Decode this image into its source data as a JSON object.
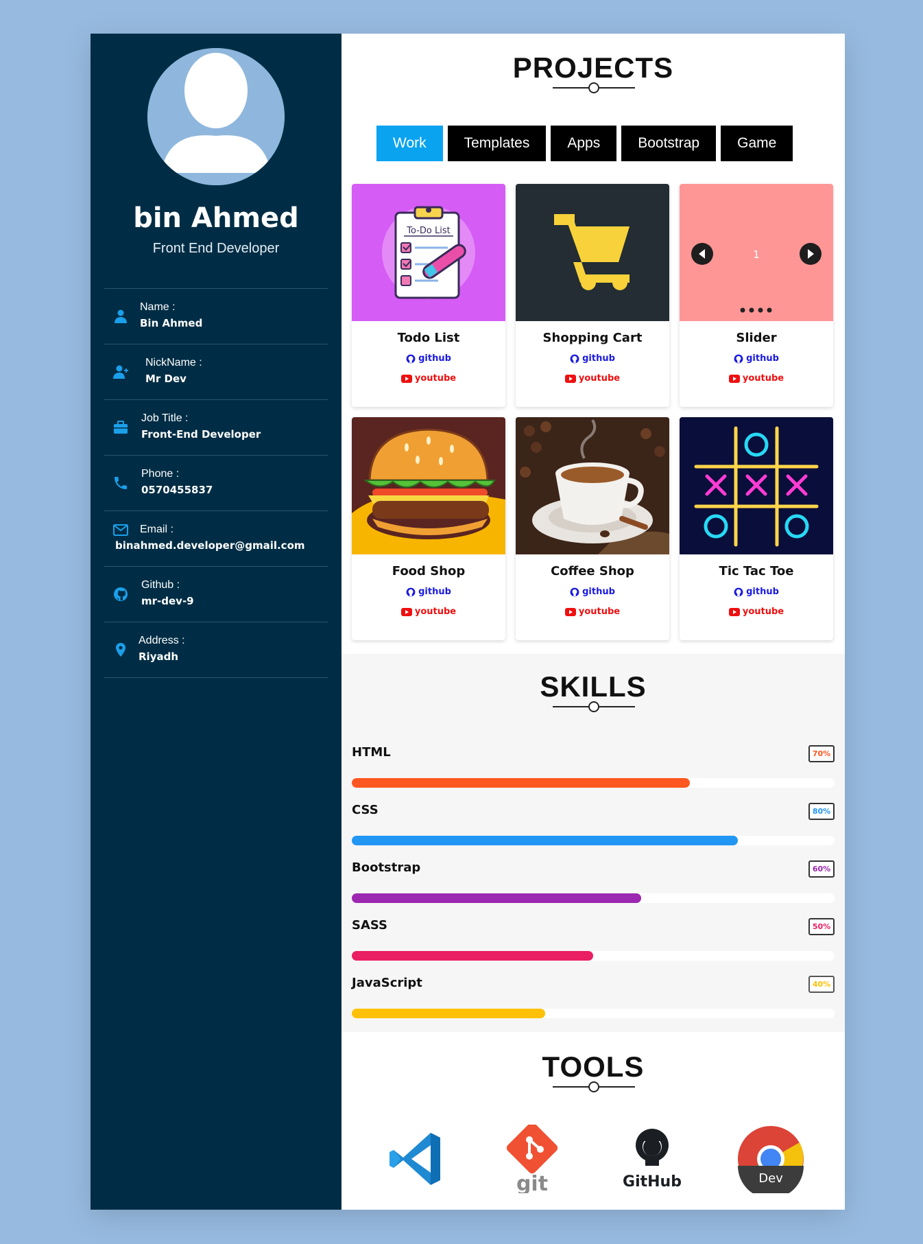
{
  "profile": {
    "name": "bin Ahmed",
    "role": "Front End Developer"
  },
  "info": [
    {
      "label": "Name :",
      "value": "Bin Ahmed",
      "icon": "user-icon"
    },
    {
      "label": "NickName :",
      "value": "Mr Dev",
      "icon": "user-plus-icon"
    },
    {
      "label": "Job Title :",
      "value": "Front-End Developer",
      "icon": "briefcase-icon"
    },
    {
      "label": "Phone :",
      "value": "0570455837",
      "icon": "phone-icon"
    },
    {
      "label": "Email :",
      "value": "binahmed.developer@gmail.com",
      "icon": "envelope-icon"
    },
    {
      "label": "Github :",
      "value": "mr-dev-9",
      "icon": "github-icon"
    },
    {
      "label": "Address :",
      "value": "Riyadh",
      "icon": "map-pin-icon"
    }
  ],
  "projects": {
    "title": "PROJECTS",
    "filters": [
      "Work",
      "Templates",
      "Apps",
      "Bootstrap",
      "Game"
    ],
    "active_filter": "Work",
    "github_label": "github",
    "youtube_label": "youtube",
    "items": [
      {
        "title": "Todo List",
        "image": "todo-list-illustration"
      },
      {
        "title": "Shopping Cart",
        "image": "shopping-cart-icon"
      },
      {
        "title": "Slider",
        "image": "slider-preview",
        "slide_number": "1"
      },
      {
        "title": "Food Shop",
        "image": "burger-illustration"
      },
      {
        "title": "Coffee Shop",
        "image": "coffee-cup-photo"
      },
      {
        "title": "Tic Tac Toe",
        "image": "tic-tac-toe-neon"
      }
    ],
    "todo_image_text": "To-Do List"
  },
  "skills": {
    "title": "SKILLS",
    "items": [
      {
        "name": "HTML",
        "percent": 70,
        "label": "70%",
        "color": "#ff5722"
      },
      {
        "name": "CSS",
        "percent": 80,
        "label": "80%",
        "color": "#2196f3"
      },
      {
        "name": "Bootstrap",
        "percent": 60,
        "label": "60%",
        "color": "#9c27b0"
      },
      {
        "name": "SASS",
        "percent": 50,
        "label": "50%",
        "color": "#e91e63"
      },
      {
        "name": "JavaScript",
        "percent": 40,
        "label": "40%",
        "color": "#ffc107"
      }
    ]
  },
  "tools": {
    "title": "TOOLS",
    "items": [
      {
        "name": "vscode-icon"
      },
      {
        "name": "git-icon",
        "text": "git"
      },
      {
        "name": "github-logo-icon",
        "text": "GitHub"
      },
      {
        "name": "chrome-dev-icon",
        "text": "Dev"
      }
    ]
  },
  "colors": {
    "sidebar": "#002d45",
    "accent": "#0aa3f0",
    "page_bg": "#97bbe0"
  }
}
